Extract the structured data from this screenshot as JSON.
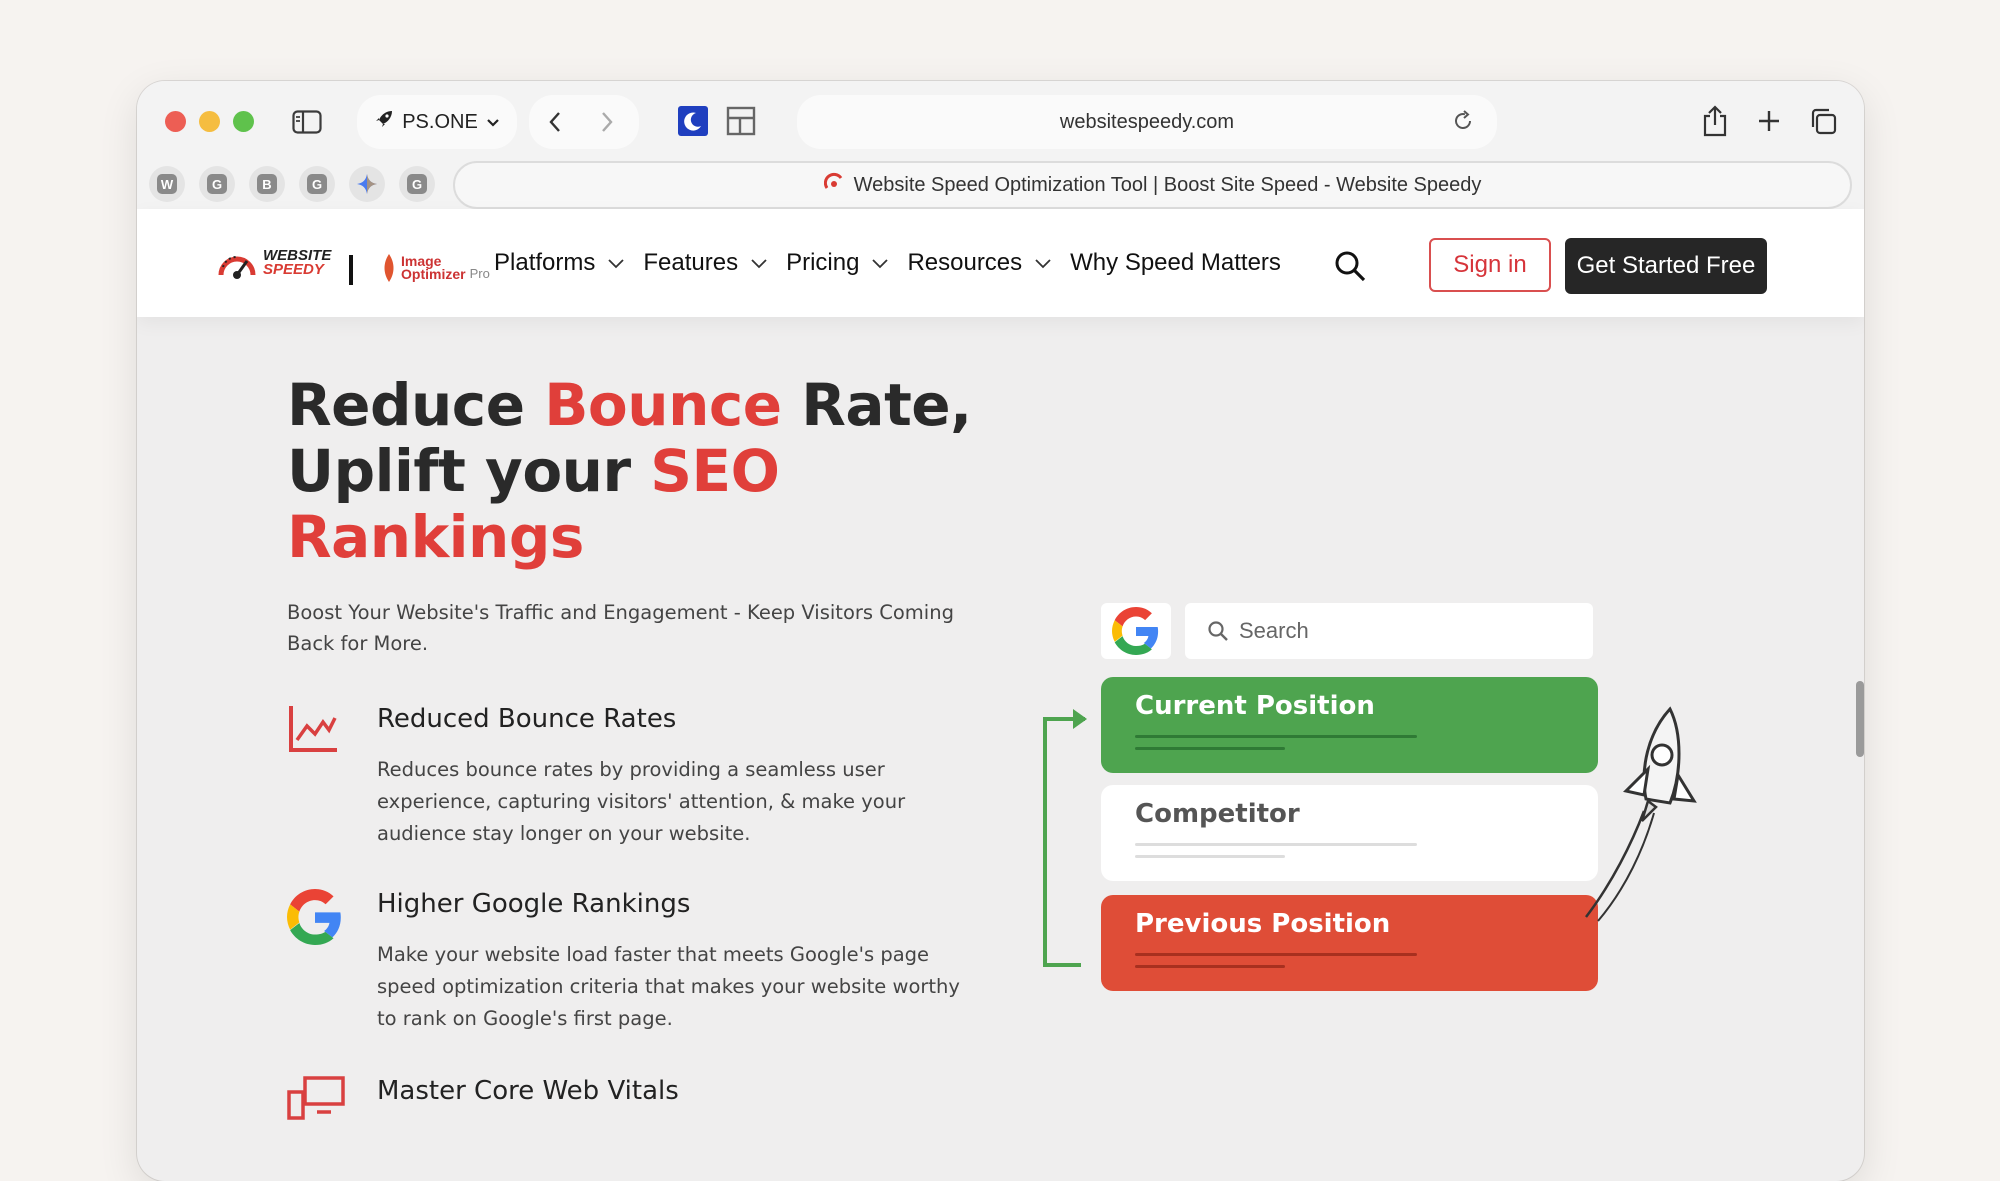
{
  "browser": {
    "profile_label": "PS.ONE",
    "url": "websitespeedy.com",
    "tab_title": "Website Speed Optimization Tool | Boost Site Speed - Website Speedy",
    "bookmarks": [
      "W",
      "G",
      "B",
      "G",
      "G"
    ]
  },
  "site": {
    "logo_line1": "WEBSITE",
    "logo_line2": "SPEEDY",
    "partner_logo_line1": "Image",
    "partner_logo_line2": "Optimizer",
    "partner_logo_suffix": "Pro",
    "nav": [
      {
        "label": "Platforms"
      },
      {
        "label": "Features"
      },
      {
        "label": "Pricing"
      },
      {
        "label": "Resources"
      },
      {
        "label": "Why Speed Matters"
      }
    ],
    "signin_label": "Sign in",
    "cta_label": "Get Started Free"
  },
  "hero": {
    "title_part1": "Reduce ",
    "title_red1": "Bounce",
    "title_part2": " Rate,",
    "title_part3": "Uplift your ",
    "title_red2": "SEO",
    "title_red3": "Rankings",
    "subtitle": "Boost Your Website's Traffic and Engagement - Keep Visitors Coming Back for More."
  },
  "features": [
    {
      "title": "Reduced Bounce Rates",
      "desc": "Reduces bounce rates by providing a seamless user experience, capturing visitors' attention, & make your audience stay longer on your website."
    },
    {
      "title": "Higher Google Rankings",
      "desc": "Make your website load faster that meets Google's page speed optimization criteria that makes your website worthy to rank on Google's first page."
    },
    {
      "title": "Master Core Web Vitals",
      "desc": ""
    }
  ],
  "illustration": {
    "search_placeholder": "Search",
    "card_current": "Current Position",
    "card_competitor": "Competitor",
    "card_previous": "Previous Position"
  },
  "colors": {
    "brand_red": "#e03f3a",
    "green": "#4ea44f",
    "orange_red": "#df4d37"
  }
}
